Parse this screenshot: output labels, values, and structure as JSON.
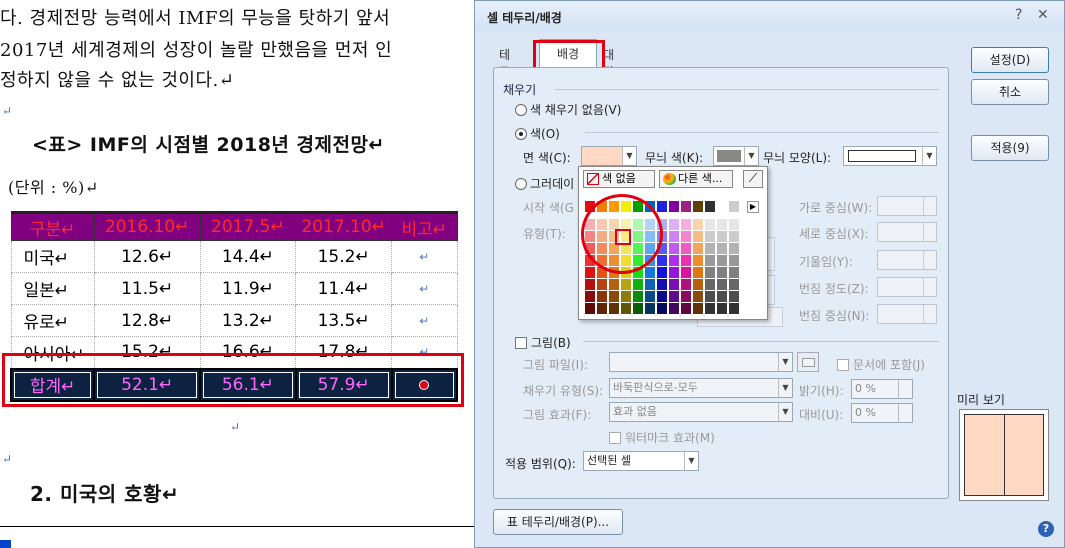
{
  "doc": {
    "paragraphs": [
      "다. 경제전망 능력에서 IMF의 무능을 탓하기 앞서",
      "2017년 세계경제의 성장이 놀랄 만했음을 먼저 인",
      "정하지 않을 수 없는 것이다.↵"
    ],
    "blank_marks": [
      "↵",
      "↵",
      "↵"
    ],
    "table_title": "<표> IMF의 시점별 2018년 경제전망↵",
    "unit": "(단위 : %)↵",
    "table": {
      "headers": [
        "구분↵",
        "2016.10↵",
        "2017.5↵",
        "2017.10↵",
        "비고↵"
      ],
      "rows": [
        [
          "미국↵",
          "12.6↵",
          "14.4↵",
          "15.2↵",
          "↵"
        ],
        [
          "일본↵",
          "11.5↵",
          "11.9↵",
          "11.4↵",
          "↵"
        ],
        [
          "유로↵",
          "12.8↵",
          "13.2↵",
          "13.5↵",
          "↵"
        ],
        [
          "아시아↵",
          "15.2↵",
          "16.6↵",
          "17.8↵",
          "↵"
        ]
      ],
      "sum_row": [
        "합계↵",
        "52.1↵",
        "56.1↵",
        "57.9↵",
        ""
      ]
    },
    "heading2": "2. 미국의 호황↵"
  },
  "dialog": {
    "title": "셀 테두리/배경",
    "help_glyph": "?",
    "close_glyph": "✕",
    "tabs": [
      "테두리",
      "배경",
      "대각선"
    ],
    "buttons": {
      "ok": "설정(D)",
      "cancel": "취소",
      "apply": "적용(9)",
      "table_border": "표 테두리/배경(P)..."
    },
    "fill_section": "채우기",
    "no_fill": "색 채우기 없음(V)",
    "color": "색(O)",
    "face_color": "면 색(C):",
    "pattern_color": "무늬 색(K):",
    "pattern_shape": "무늬 모양(L):",
    "gradient": "그러데이",
    "start_color": "시작 색(G",
    "type": "유형(T):",
    "horiz_center": "가로 중심(W):",
    "vert_center": "세로 중심(X):",
    "tilt": "기울임(Y):",
    "blur_degree": "번짐 정도(Z):",
    "blur_center": "번짐 중심(N):",
    "picture": "그림(B)",
    "picture_file": "그림 파일(I):",
    "in_document": "문서에 포함(J)",
    "fill_type": "채우기 유형(S):",
    "fill_type_value": "바둑판식으로-모두",
    "brightness": "밝기(H):",
    "brightness_value": "0 %",
    "picture_effect": "그림 효과(F):",
    "picture_effect_value": "효과 없음",
    "contrast": "대비(U):",
    "contrast_value": "0 %",
    "watermark": "워터마크 효과(M)",
    "apply_range": "적용 범위(Q):",
    "apply_range_value": "선택된 셀",
    "preview": "미리 보기",
    "palette_no_color": "색 없음",
    "palette_other": "다른 색...",
    "combo_arrow": "▼",
    "palette_more": "▶"
  },
  "colors": {
    "face_color": "#ffd9c4",
    "pattern_color": "#888888",
    "accent_red": "#e00012",
    "header_bg": "#800080",
    "sum_bg": "#0d2240"
  }
}
